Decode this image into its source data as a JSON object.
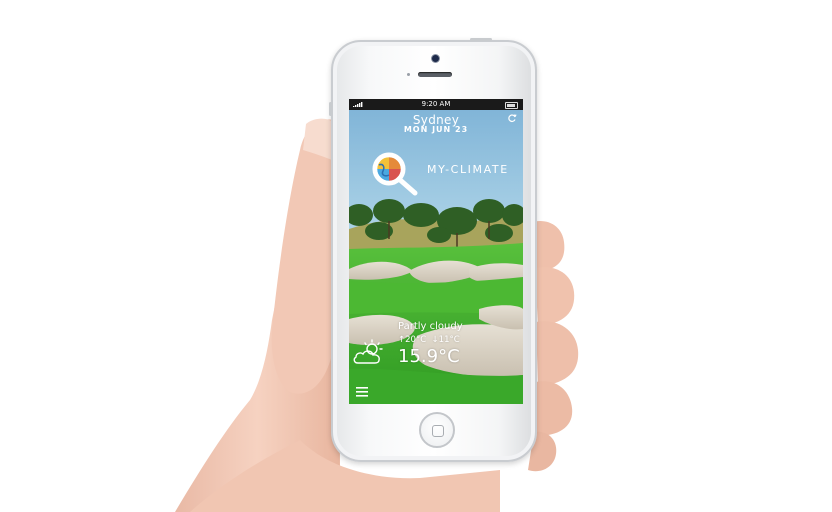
{
  "status_bar": {
    "time": "9:20 AM"
  },
  "location": {
    "city": "Sydney",
    "date": "MON JUN 23"
  },
  "brand": {
    "name": "MY-CLIMATE"
  },
  "weather": {
    "condition": "Partly cloudy",
    "high": "20°C",
    "low": "11°C",
    "current_temp": "15.9°C",
    "condition_icon": "partly-cloudy-icon"
  },
  "icons": {
    "refresh": "refresh-icon",
    "menu": "hamburger-menu-icon",
    "logo": "magnifier-logo-icon"
  },
  "colors": {
    "sky": "#8fc0dc",
    "grass": "#3fae2f",
    "sand": "#d9d2c4",
    "text": "#ffffff"
  }
}
